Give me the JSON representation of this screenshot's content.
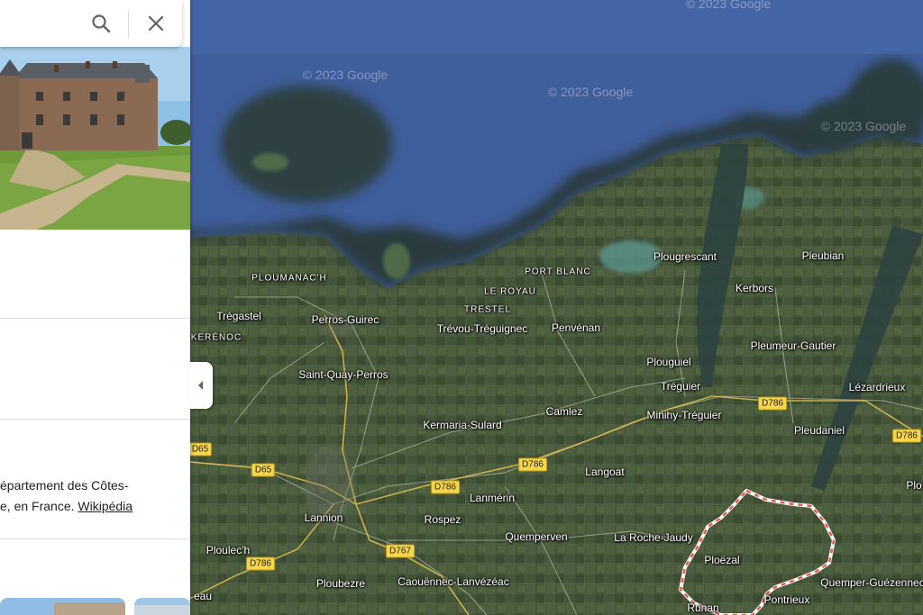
{
  "search": {
    "search_icon": "search-icon",
    "close_icon": "close-icon"
  },
  "panel": {
    "photo_subject": "castle-photo",
    "description_line1": "épartement des Côtes-",
    "description_line2": "e, en France.",
    "wikipedia_link": "Wikipédia"
  },
  "map": {
    "watermarks": [
      "© 2023 Google",
      "© 2023 Google",
      "© 2023 Google",
      "© 2023 Google"
    ],
    "places": [
      {
        "name": "PLOUMANAC'H",
        "caps": true
      },
      {
        "name": "Trégastel",
        "caps": false
      },
      {
        "name": "Perros-Guirec",
        "caps": false
      },
      {
        "name": "KERÉNOC",
        "caps": true
      },
      {
        "name": "Saint-Quay-Perros",
        "caps": false
      },
      {
        "name": "PORT BLANC",
        "caps": true
      },
      {
        "name": "LE ROYAU",
        "caps": true
      },
      {
        "name": "TRESTEL",
        "caps": true
      },
      {
        "name": "Trévou-Tréguignec",
        "caps": false
      },
      {
        "name": "Penvénan",
        "caps": false
      },
      {
        "name": "Plougrescant",
        "caps": false
      },
      {
        "name": "Pleubian",
        "caps": false
      },
      {
        "name": "Kerbors",
        "caps": false
      },
      {
        "name": "Pleumeur-Gautier",
        "caps": false
      },
      {
        "name": "Plouguiel",
        "caps": false
      },
      {
        "name": "Tréguier",
        "caps": false
      },
      {
        "name": "Lézardrieux",
        "caps": false
      },
      {
        "name": "Camlez",
        "caps": false
      },
      {
        "name": "Minihy-Tréguier",
        "caps": false
      },
      {
        "name": "Kermaria-Sulard",
        "caps": false
      },
      {
        "name": "Pleudaniel",
        "caps": false
      },
      {
        "name": "Langoat",
        "caps": false
      },
      {
        "name": "Lanmérin",
        "caps": false
      },
      {
        "name": "Lannion",
        "caps": false
      },
      {
        "name": "Rospez",
        "caps": false
      },
      {
        "name": "Quemperven",
        "caps": false
      },
      {
        "name": "La Roche-Jaudy",
        "caps": false
      },
      {
        "name": "Ploëzal",
        "caps": false
      },
      {
        "name": "Quemper-Guézennec",
        "caps": false
      },
      {
        "name": "Pontrieux",
        "caps": false
      },
      {
        "name": "Ploulec'h",
        "caps": false
      },
      {
        "name": "Ploubezre",
        "caps": false
      },
      {
        "name": "Caouënnec-Lanvézéac",
        "caps": false
      },
      {
        "name": "Runan",
        "caps": false
      },
      {
        "name": "eau",
        "caps": false
      },
      {
        "name": "Plo",
        "caps": false
      }
    ],
    "roads": [
      "D786",
      "D786",
      "D786",
      "D786",
      "D65",
      "D65",
      "D767",
      "D786",
      "D786"
    ]
  },
  "colors": {
    "sea": "#3f5e9c",
    "land": "#3e5033",
    "route": "#e8584c",
    "road_shield": "#f7d54a"
  }
}
